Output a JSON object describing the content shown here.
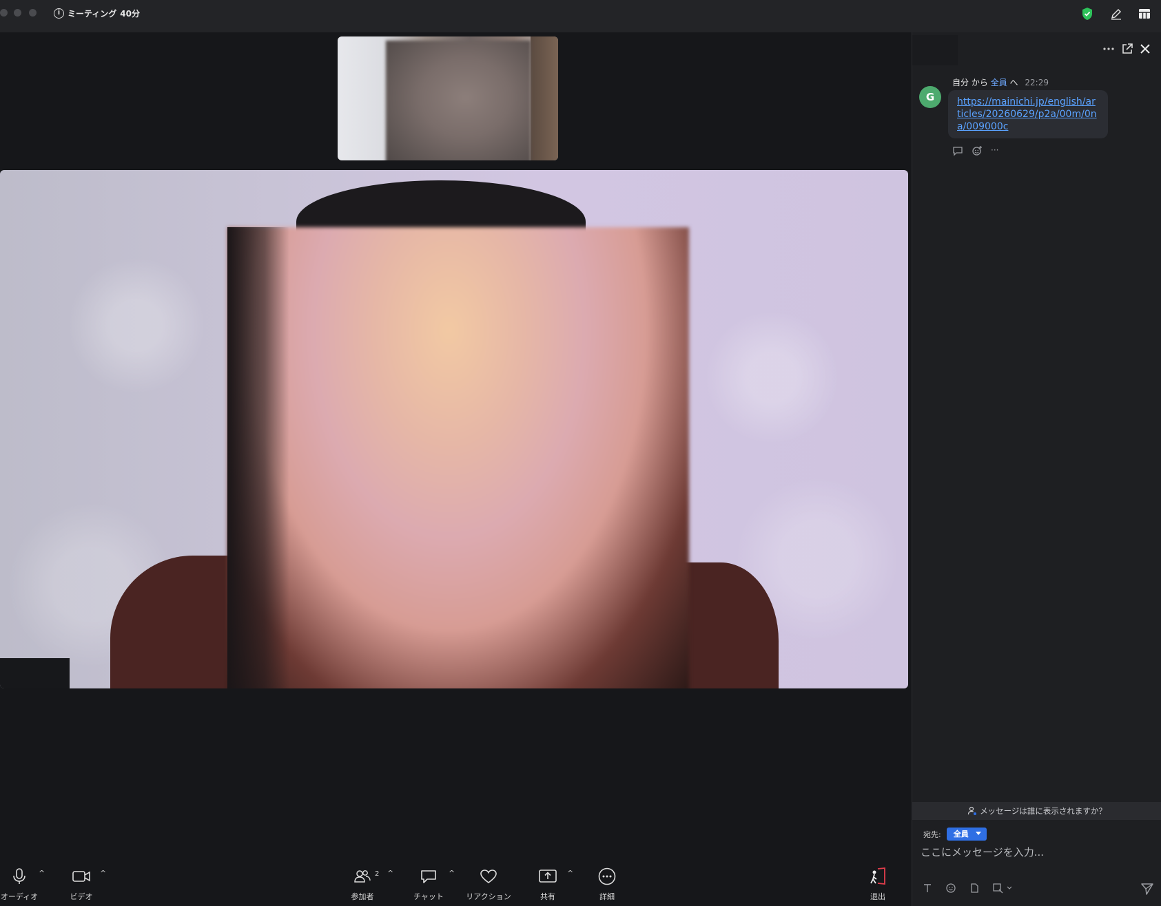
{
  "titlebar": {
    "meeting_label": "ミーティング",
    "duration": "40分",
    "info_icon_glyph": "i",
    "icons": [
      "shield-check-icon",
      "pencil-icon",
      "grid-layout-icon"
    ],
    "shield_color": "#2dc25a"
  },
  "toolbar": {
    "audio": "オーディオ",
    "video": "ビデオ",
    "participants": "参加者",
    "participant_count": "2",
    "chat": "チャット",
    "reactions": "リアクション",
    "share": "共有",
    "more": "詳細",
    "leave": "退出",
    "leave_color": "#e23d4b",
    "caret": "^"
  },
  "chat": {
    "message": {
      "avatar_initial": "G",
      "avatar_color": "#4daa6e",
      "sender": "自分",
      "from_word": "から",
      "recipient": "全員",
      "to_word": "へ",
      "time": "22:29",
      "link_text": "https://mainichi.jp/english/articles/20260629/p2a/00m/0na/009000c",
      "more_actions": "···"
    },
    "notice": "メッセージは誰に表示されますか？",
    "to_label": "宛先:",
    "to_value": "全員",
    "input_placeholder": "ここにメッセージを入力..."
  }
}
